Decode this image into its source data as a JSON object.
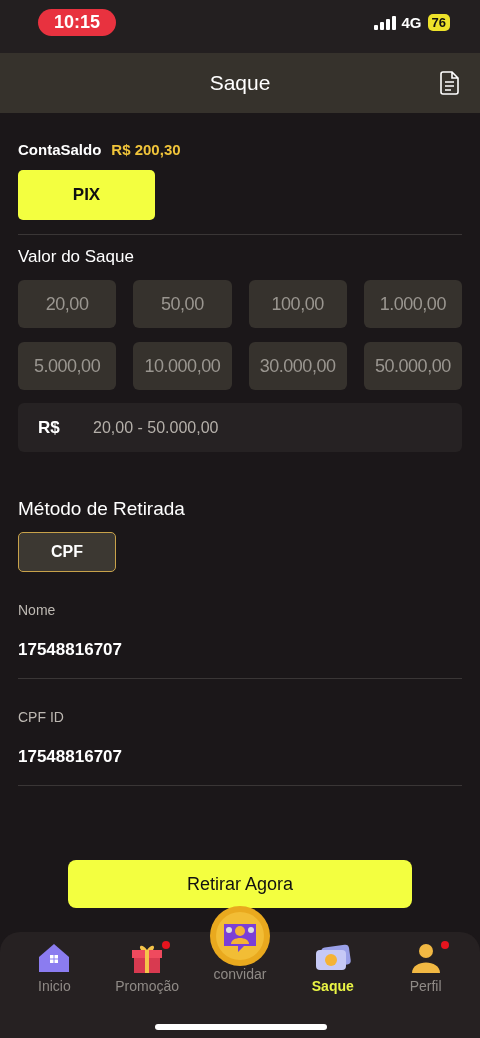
{
  "status_bar": {
    "time": "10:15",
    "network": "4G",
    "battery": "76"
  },
  "header": {
    "title": "Saque"
  },
  "balance": {
    "label": "ContaSaldo",
    "value": "R$ 200,30"
  },
  "channels": [
    {
      "label": "PIX",
      "selected": true
    }
  ],
  "amount": {
    "title": "Valor do Saque",
    "presets": [
      "20,00",
      "50,00",
      "100,00",
      "1.000,00",
      "5.000,00",
      "10.000,00",
      "30.000,00",
      "50.000,00"
    ],
    "currency": "R$",
    "placeholder": "20,00 - 50.000,00"
  },
  "method": {
    "title": "Método de Retirada",
    "options": [
      {
        "label": "CPF",
        "selected": true
      }
    ]
  },
  "fields": [
    {
      "label": "Nome",
      "value": "17548816707"
    },
    {
      "label": "CPF ID",
      "value": "17548816707"
    }
  ],
  "submit": "Retirar Agora",
  "tabs": [
    {
      "label": "Inicio",
      "kind": "home",
      "selected": false,
      "badge": false
    },
    {
      "label": "Promoção",
      "kind": "gift",
      "selected": false,
      "badge": true
    },
    {
      "label": "convidar",
      "kind": "invite",
      "selected": false,
      "badge": false
    },
    {
      "label": "Saque",
      "kind": "cash",
      "selected": true,
      "badge": false
    },
    {
      "label": "Perfil",
      "kind": "profile",
      "selected": false,
      "badge": true
    }
  ]
}
